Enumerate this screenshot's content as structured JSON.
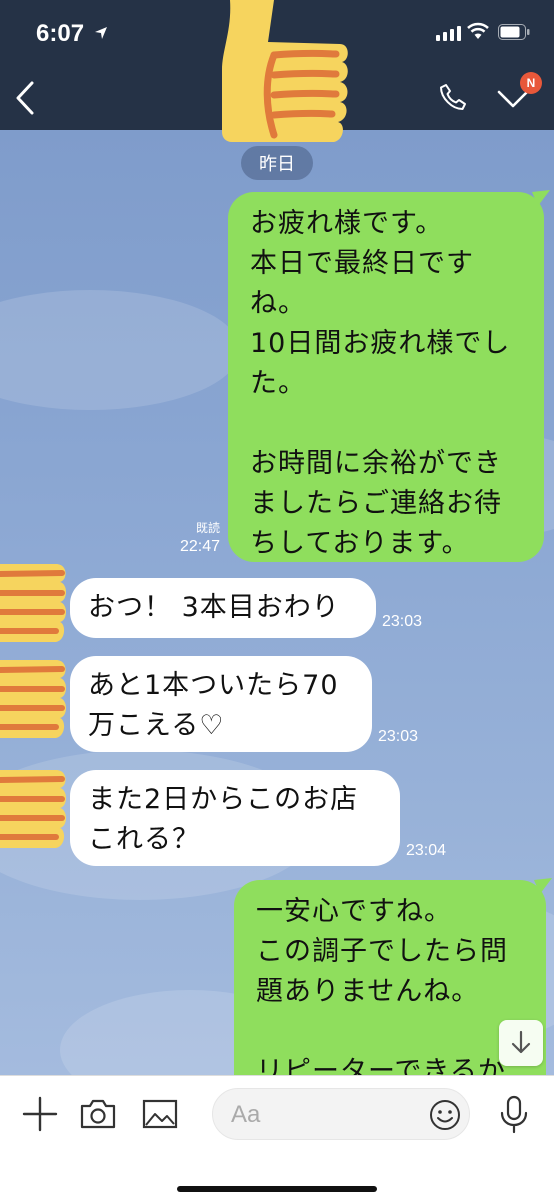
{
  "status_bar": {
    "time": "6:07"
  },
  "header": {
    "notification_badge": "N"
  },
  "chat": {
    "date_separator": "昨日",
    "messages": [
      {
        "side": "out",
        "text": "お疲れ様です。\n本日で最終日です\nね。\n10日間お疲れ様でし\nた。\n\nお時間に余裕ができ\nましたらご連絡お待\nちしております。",
        "read": "既読",
        "time": "22:47"
      },
      {
        "side": "in",
        "text": "おつ！ 3本目おわり",
        "time": "23:03"
      },
      {
        "side": "in",
        "text": "あと1本ついたら70\n万こえる♡",
        "time": "23:03"
      },
      {
        "side": "in",
        "text": "また2日からこのお店\nこれる？",
        "time": "23:04"
      },
      {
        "side": "out",
        "text": "一安心ですね。\nこの調子でしたら問\n題ありませんね。\n\nリピーターできるか"
      }
    ]
  },
  "input": {
    "placeholder": "Aa"
  },
  "colors": {
    "header_bg": "#253246",
    "outgoing_bubble": "#8fde5d",
    "incoming_bubble": "#ffffff",
    "badge": "#e8583a"
  },
  "icons": [
    "location-arrow-icon",
    "wifi-icon",
    "battery-icon",
    "back-chevron-icon",
    "phone-icon",
    "chevron-down-icon",
    "thumbs-up-sticker",
    "plus-icon",
    "camera-icon",
    "image-icon",
    "emoji-icon",
    "microphone-icon",
    "arrow-down-icon"
  ]
}
